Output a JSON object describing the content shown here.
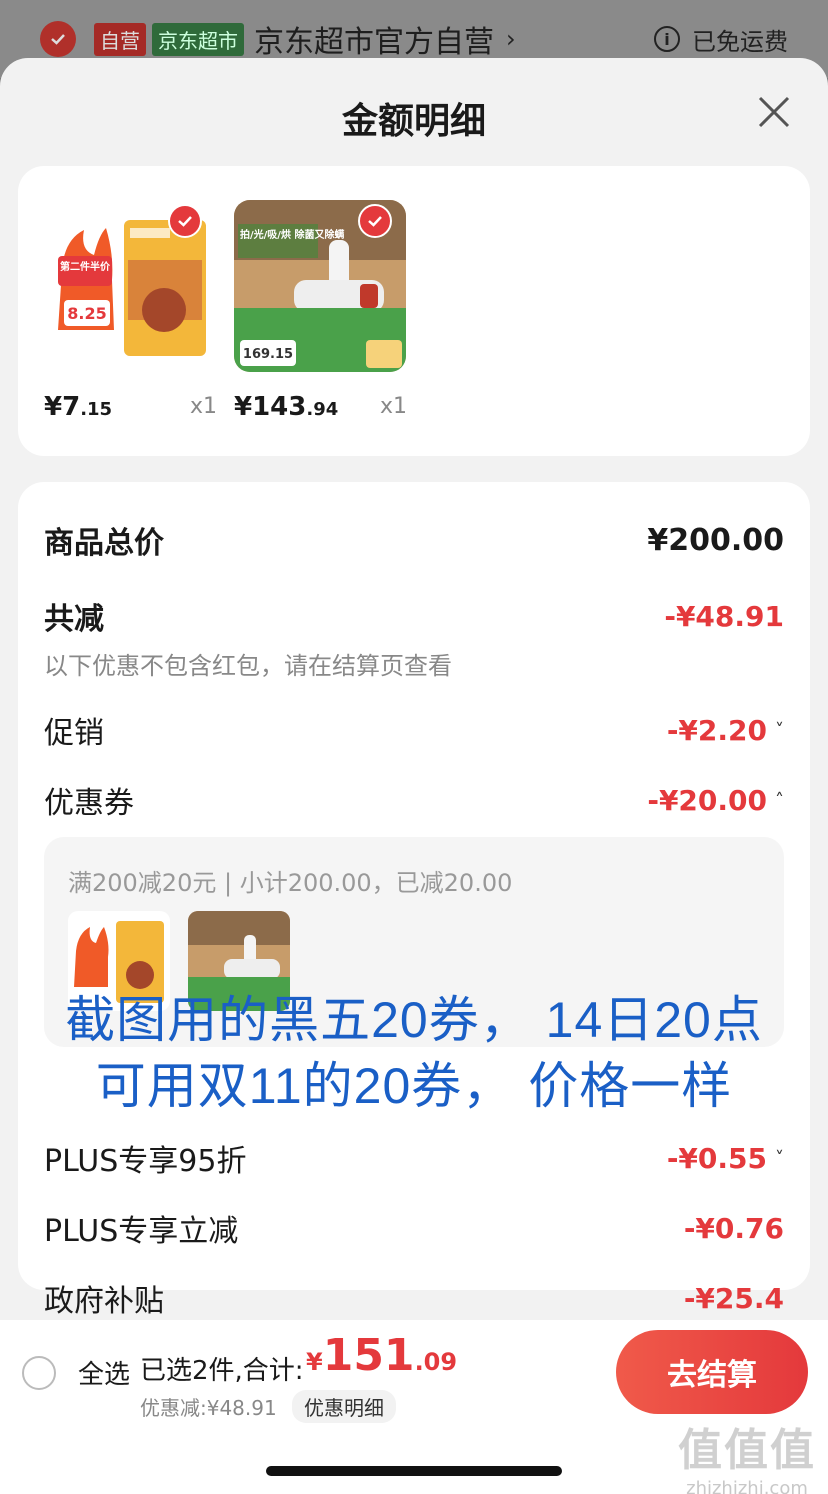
{
  "store": {
    "badge_self": "自营",
    "badge_jd": "京东超市",
    "name": "京东超市官方自营",
    "chevron": "›",
    "shipping": "已免运费",
    "info_glyph": "i"
  },
  "sheet": {
    "title": "金额明细",
    "close_glyph": "×"
  },
  "products": [
    {
      "price_int": "¥7",
      "price_dec": ".15",
      "qty": "x1",
      "image_icon": "sugar-package-icon",
      "promo_tag": "第二件半价",
      "promo_price": "8.25"
    },
    {
      "price_int": "¥143",
      "price_dec": ".94",
      "qty": "x1",
      "image_icon": "mite-vacuum-icon",
      "promo_tag": "拍/光/吸/烘 除菌又除螨",
      "promo_price": "169.15"
    }
  ],
  "details": {
    "total_label": "商品总价",
    "total_value": "¥200.00",
    "reduce_label": "共减",
    "reduce_value": "-¥48.91",
    "reduce_note": "以下优惠不包含红包，请在结算页查看",
    "promo_label": "促销",
    "promo_value": "-¥2.20",
    "coupon_label": "优惠券",
    "coupon_value": "-¥20.00",
    "coupon_desc": "满200减20元 | 小计200.00，已减20.00",
    "plus95_label": "PLUS专享95折",
    "plus95_value": "-¥0.55",
    "plus_reduce_label": "PLUS专享立减",
    "plus_reduce_value": "-¥0.76",
    "gov_label": "政府补贴",
    "gov_value": "-¥25.4",
    "chev_down": "˅",
    "chev_up": "˄"
  },
  "overlay": {
    "line1": "截图用的黑五20券，  14日20点",
    "line2": "可用双11的20券，  价格一样"
  },
  "bottom": {
    "select_all": "全选",
    "selected": "已选2件,合计:",
    "total_sym": "¥",
    "total_int": "151",
    "total_dec": ".09",
    "discount": "优惠减:¥48.91",
    "detail_chip": "优惠明细",
    "checkout": "去结算"
  },
  "watermark": {
    "big": "值值值",
    "small": "zhizhizhi.com"
  },
  "colors": {
    "accent": "#e4393c",
    "overlay_text": "#1a5fc6"
  }
}
